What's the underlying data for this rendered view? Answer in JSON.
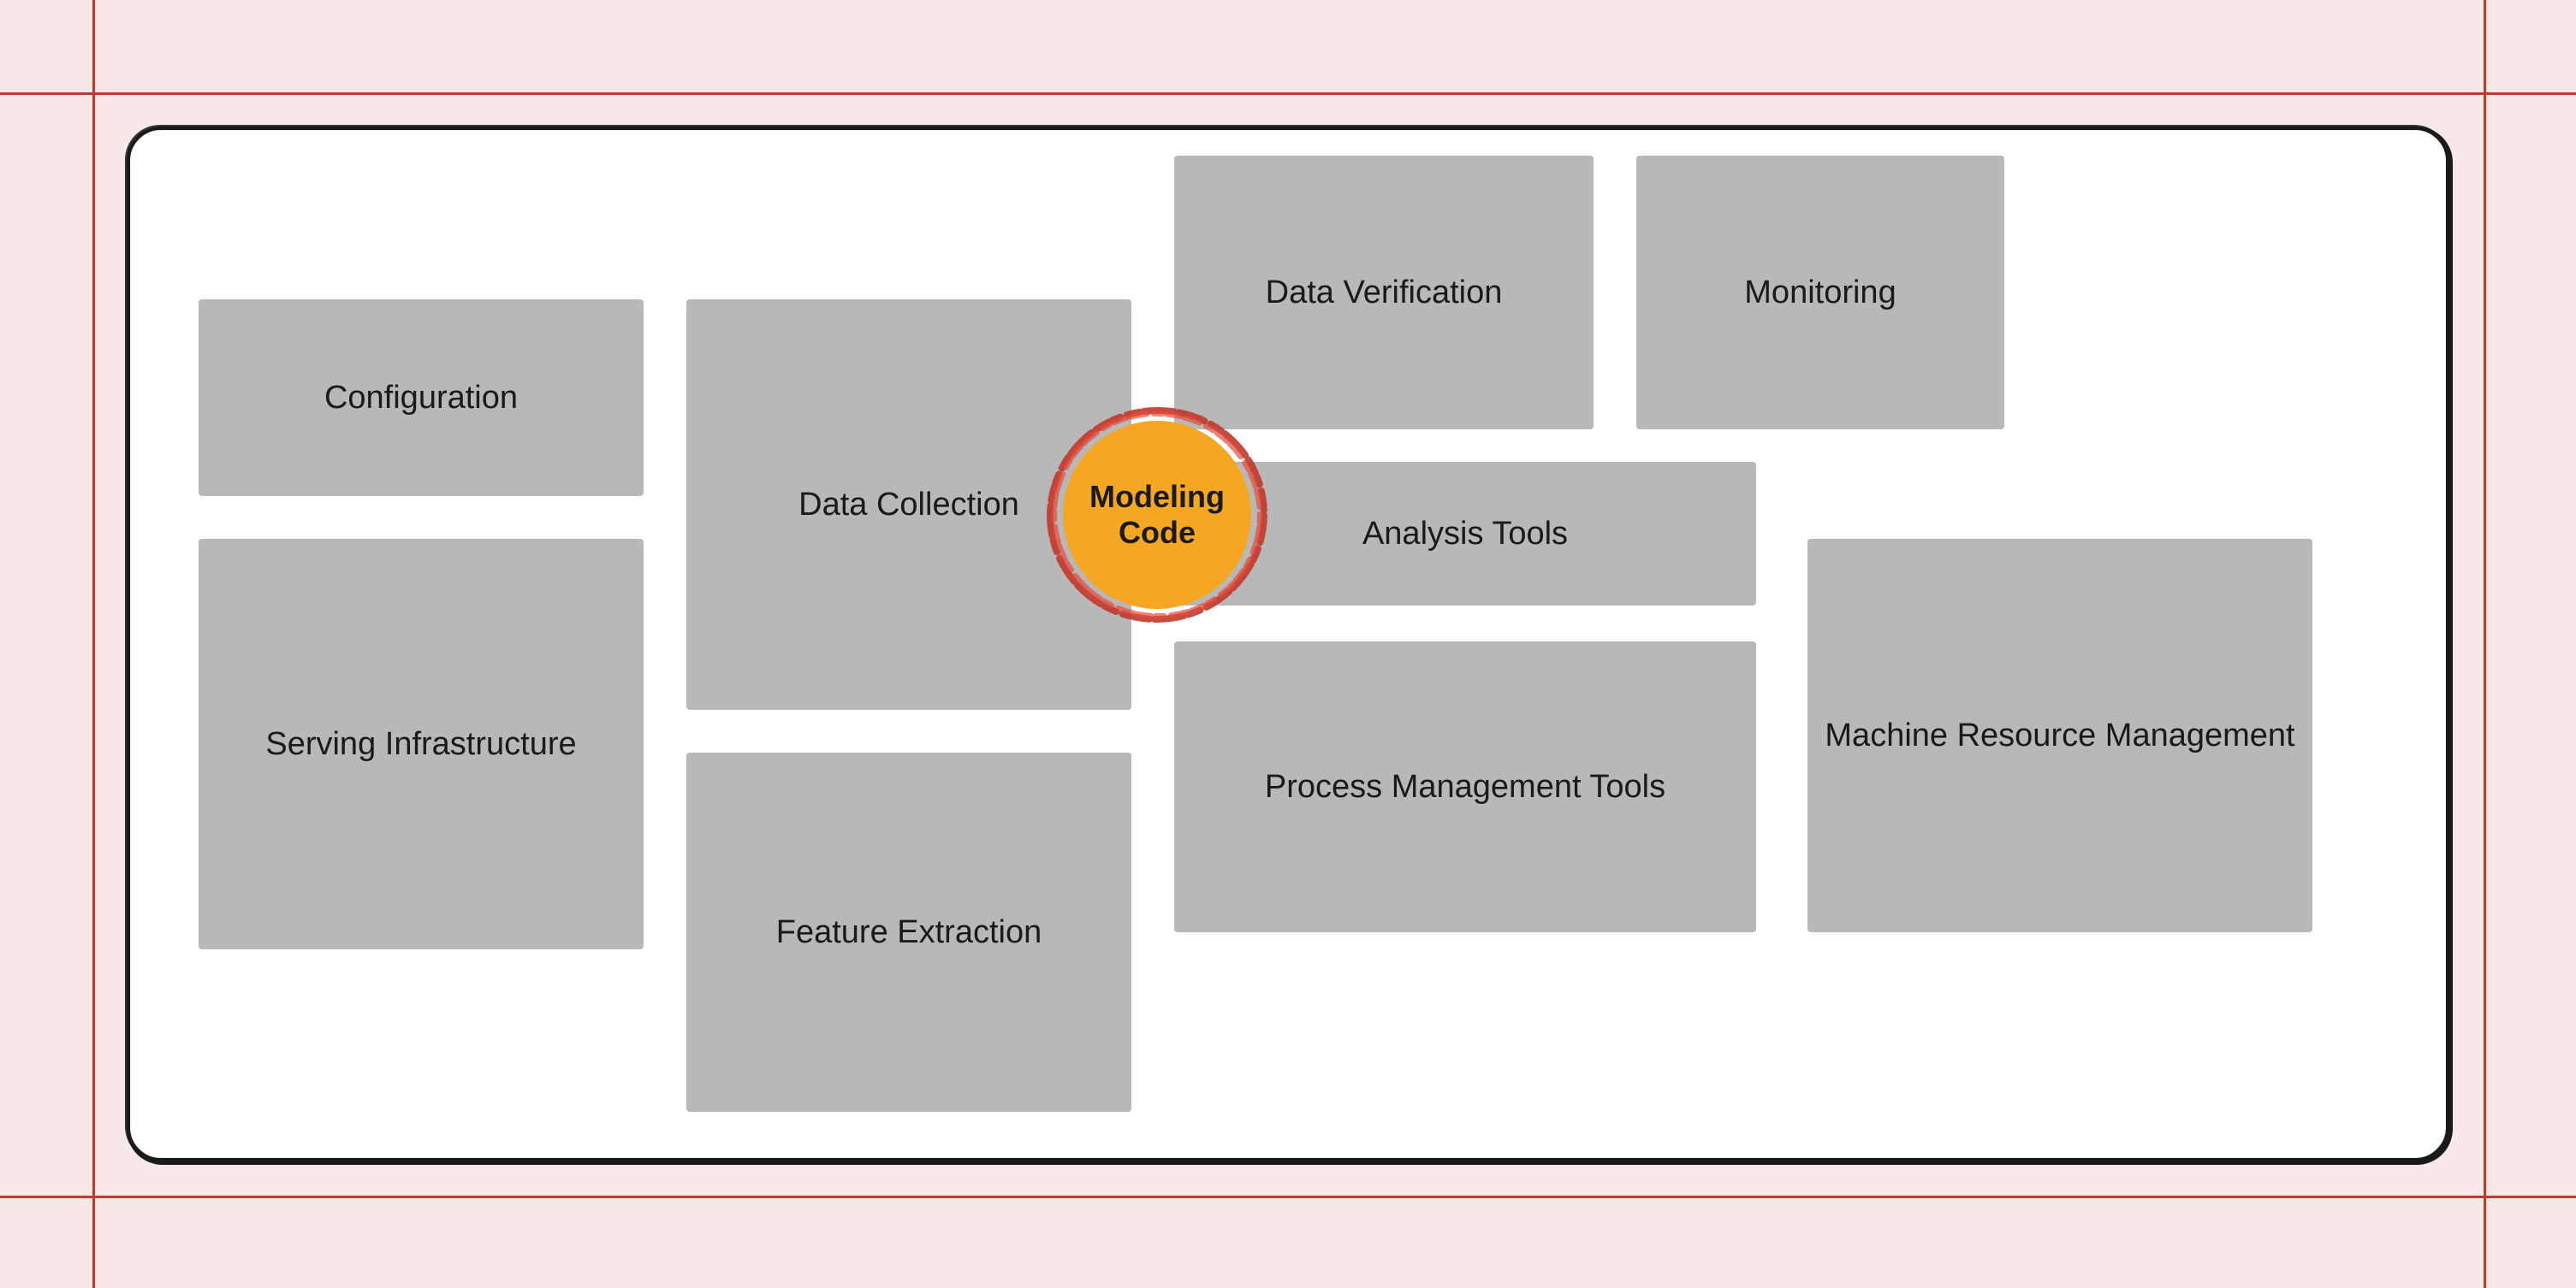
{
  "background_color": "#f9e8e8",
  "boxes": {
    "configuration": {
      "label": "Configuration"
    },
    "serving_infrastructure": {
      "label": "Serving Infrastructure"
    },
    "data_collection": {
      "label": "Data Collection"
    },
    "data_verification": {
      "label": "Data Verification"
    },
    "monitoring": {
      "label": "Monitoring"
    },
    "analysis_tools": {
      "label": "Analysis Tools"
    },
    "process_management": {
      "label": "Process Management Tools"
    },
    "machine_resource": {
      "label": "Machine Resource Management"
    },
    "feature_extraction": {
      "label": "Feature Extraction"
    },
    "modeling_code": {
      "label": "Modeling Code"
    }
  }
}
